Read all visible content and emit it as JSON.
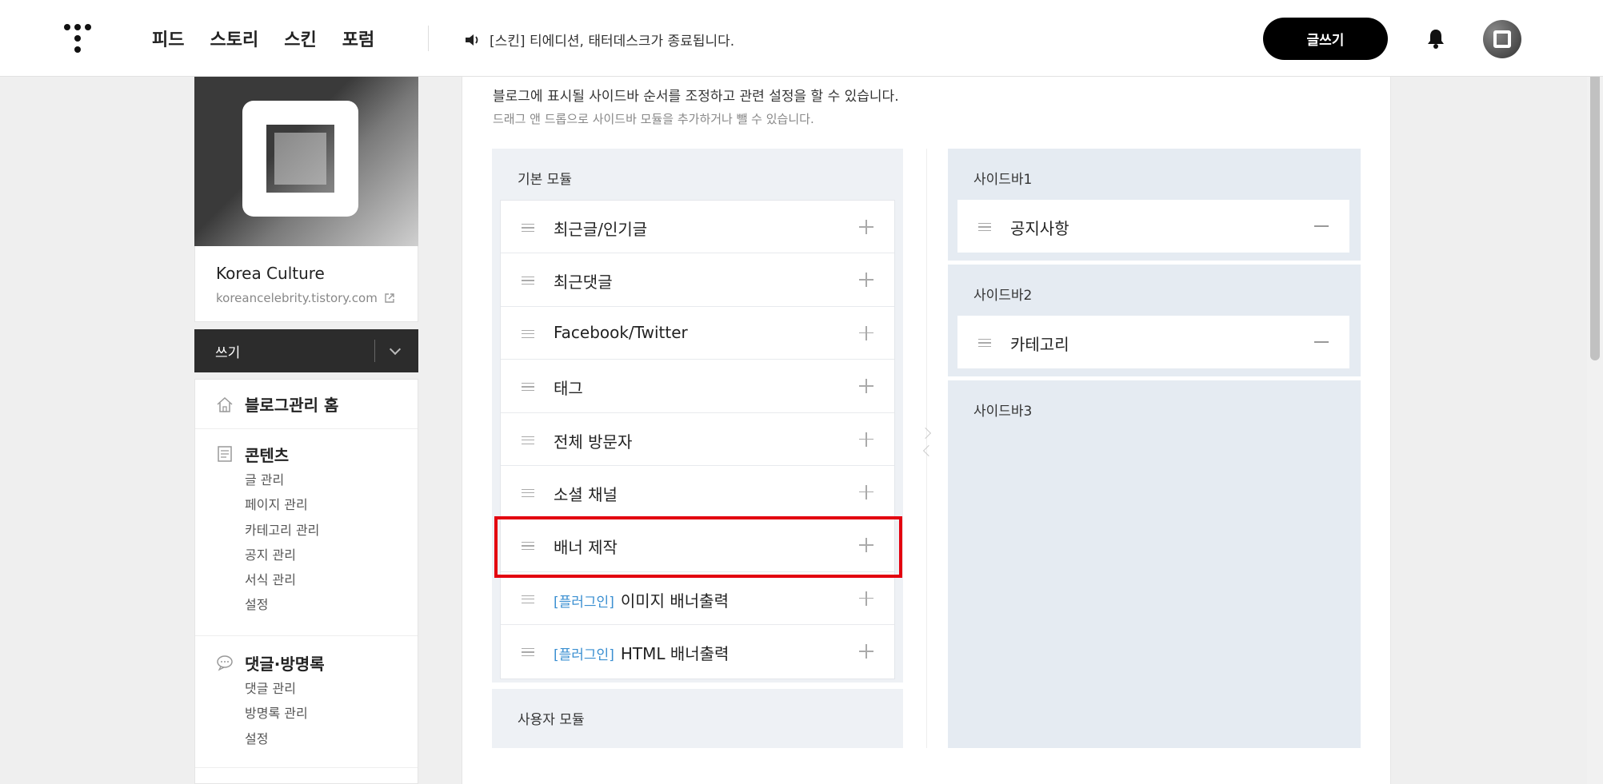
{
  "header": {
    "nav": [
      "피드",
      "스토리",
      "스킨",
      "포럼"
    ],
    "notice": "[스킨] 티에디션, 태터데스크가 종료됩니다.",
    "write_button": "글쓰기"
  },
  "blog": {
    "name": "Korea Culture",
    "url": "koreancelebrity.tistory.com"
  },
  "sidebar": {
    "write_menu": "쓰기",
    "home": "블로그관리 홈",
    "groups": [
      {
        "title": "콘텐츠",
        "items": [
          "글 관리",
          "페이지 관리",
          "카테고리 관리",
          "공지 관리",
          "서식 관리",
          "설정"
        ]
      },
      {
        "title": "댓글·방명록",
        "items": [
          "댓글 관리",
          "방명록 관리",
          "설정"
        ]
      }
    ]
  },
  "main": {
    "description": "블로그에 표시될 사이드바 순서를 조정하고 관련 설정을 할 수 있습니다.",
    "hint": "드래그 앤 드롭으로 사이드바 모듈을 추가하거나 뺄 수 있습니다.",
    "basic_modules_title": "기본 모듈",
    "basic_modules": [
      {
        "tag": "",
        "label": "최근글/인기글"
      },
      {
        "tag": "",
        "label": "최근댓글"
      },
      {
        "tag": "",
        "label": "Facebook/Twitter"
      },
      {
        "tag": "",
        "label": "태그"
      },
      {
        "tag": "",
        "label": "전체 방문자"
      },
      {
        "tag": "",
        "label": "소셜 채널"
      },
      {
        "tag": "",
        "label": "배너 제작"
      },
      {
        "tag": "[플러그인]",
        "label": "이미지 배너출력"
      },
      {
        "tag": "[플러그인]",
        "label": "HTML 배너출력"
      }
    ],
    "user_modules_title": "사용자 모듈",
    "sidebars": [
      {
        "title": "사이드바1",
        "items": [
          "공지사항"
        ]
      },
      {
        "title": "사이드바2",
        "items": [
          "카테고리"
        ]
      },
      {
        "title": "사이드바3",
        "items": []
      }
    ]
  },
  "colors": {
    "highlight": "#e3000f",
    "plugin_tag": "#3a8fd1",
    "dark": "#2c2c2c"
  }
}
